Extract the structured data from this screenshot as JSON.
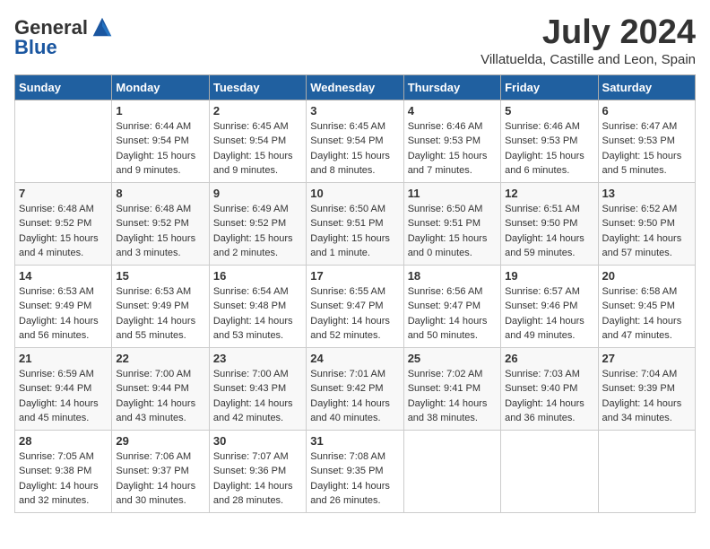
{
  "header": {
    "logo_general": "General",
    "logo_blue": "Blue",
    "title": "July 2024",
    "subtitle": "Villatuelda, Castille and Leon, Spain"
  },
  "days_of_week": [
    "Sunday",
    "Monday",
    "Tuesday",
    "Wednesday",
    "Thursday",
    "Friday",
    "Saturday"
  ],
  "weeks": [
    [
      {
        "day": "",
        "content": ""
      },
      {
        "day": "1",
        "content": "Sunrise: 6:44 AM\nSunset: 9:54 PM\nDaylight: 15 hours\nand 9 minutes."
      },
      {
        "day": "2",
        "content": "Sunrise: 6:45 AM\nSunset: 9:54 PM\nDaylight: 15 hours\nand 9 minutes."
      },
      {
        "day": "3",
        "content": "Sunrise: 6:45 AM\nSunset: 9:54 PM\nDaylight: 15 hours\nand 8 minutes."
      },
      {
        "day": "4",
        "content": "Sunrise: 6:46 AM\nSunset: 9:53 PM\nDaylight: 15 hours\nand 7 minutes."
      },
      {
        "day": "5",
        "content": "Sunrise: 6:46 AM\nSunset: 9:53 PM\nDaylight: 15 hours\nand 6 minutes."
      },
      {
        "day": "6",
        "content": "Sunrise: 6:47 AM\nSunset: 9:53 PM\nDaylight: 15 hours\nand 5 minutes."
      }
    ],
    [
      {
        "day": "7",
        "content": "Sunrise: 6:48 AM\nSunset: 9:52 PM\nDaylight: 15 hours\nand 4 minutes."
      },
      {
        "day": "8",
        "content": "Sunrise: 6:48 AM\nSunset: 9:52 PM\nDaylight: 15 hours\nand 3 minutes."
      },
      {
        "day": "9",
        "content": "Sunrise: 6:49 AM\nSunset: 9:52 PM\nDaylight: 15 hours\nand 2 minutes."
      },
      {
        "day": "10",
        "content": "Sunrise: 6:50 AM\nSunset: 9:51 PM\nDaylight: 15 hours\nand 1 minute."
      },
      {
        "day": "11",
        "content": "Sunrise: 6:50 AM\nSunset: 9:51 PM\nDaylight: 15 hours\nand 0 minutes."
      },
      {
        "day": "12",
        "content": "Sunrise: 6:51 AM\nSunset: 9:50 PM\nDaylight: 14 hours\nand 59 minutes."
      },
      {
        "day": "13",
        "content": "Sunrise: 6:52 AM\nSunset: 9:50 PM\nDaylight: 14 hours\nand 57 minutes."
      }
    ],
    [
      {
        "day": "14",
        "content": "Sunrise: 6:53 AM\nSunset: 9:49 PM\nDaylight: 14 hours\nand 56 minutes."
      },
      {
        "day": "15",
        "content": "Sunrise: 6:53 AM\nSunset: 9:49 PM\nDaylight: 14 hours\nand 55 minutes."
      },
      {
        "day": "16",
        "content": "Sunrise: 6:54 AM\nSunset: 9:48 PM\nDaylight: 14 hours\nand 53 minutes."
      },
      {
        "day": "17",
        "content": "Sunrise: 6:55 AM\nSunset: 9:47 PM\nDaylight: 14 hours\nand 52 minutes."
      },
      {
        "day": "18",
        "content": "Sunrise: 6:56 AM\nSunset: 9:47 PM\nDaylight: 14 hours\nand 50 minutes."
      },
      {
        "day": "19",
        "content": "Sunrise: 6:57 AM\nSunset: 9:46 PM\nDaylight: 14 hours\nand 49 minutes."
      },
      {
        "day": "20",
        "content": "Sunrise: 6:58 AM\nSunset: 9:45 PM\nDaylight: 14 hours\nand 47 minutes."
      }
    ],
    [
      {
        "day": "21",
        "content": "Sunrise: 6:59 AM\nSunset: 9:44 PM\nDaylight: 14 hours\nand 45 minutes."
      },
      {
        "day": "22",
        "content": "Sunrise: 7:00 AM\nSunset: 9:44 PM\nDaylight: 14 hours\nand 43 minutes."
      },
      {
        "day": "23",
        "content": "Sunrise: 7:00 AM\nSunset: 9:43 PM\nDaylight: 14 hours\nand 42 minutes."
      },
      {
        "day": "24",
        "content": "Sunrise: 7:01 AM\nSunset: 9:42 PM\nDaylight: 14 hours\nand 40 minutes."
      },
      {
        "day": "25",
        "content": "Sunrise: 7:02 AM\nSunset: 9:41 PM\nDaylight: 14 hours\nand 38 minutes."
      },
      {
        "day": "26",
        "content": "Sunrise: 7:03 AM\nSunset: 9:40 PM\nDaylight: 14 hours\nand 36 minutes."
      },
      {
        "day": "27",
        "content": "Sunrise: 7:04 AM\nSunset: 9:39 PM\nDaylight: 14 hours\nand 34 minutes."
      }
    ],
    [
      {
        "day": "28",
        "content": "Sunrise: 7:05 AM\nSunset: 9:38 PM\nDaylight: 14 hours\nand 32 minutes."
      },
      {
        "day": "29",
        "content": "Sunrise: 7:06 AM\nSunset: 9:37 PM\nDaylight: 14 hours\nand 30 minutes."
      },
      {
        "day": "30",
        "content": "Sunrise: 7:07 AM\nSunset: 9:36 PM\nDaylight: 14 hours\nand 28 minutes."
      },
      {
        "day": "31",
        "content": "Sunrise: 7:08 AM\nSunset: 9:35 PM\nDaylight: 14 hours\nand 26 minutes."
      },
      {
        "day": "",
        "content": ""
      },
      {
        "day": "",
        "content": ""
      },
      {
        "day": "",
        "content": ""
      }
    ]
  ]
}
